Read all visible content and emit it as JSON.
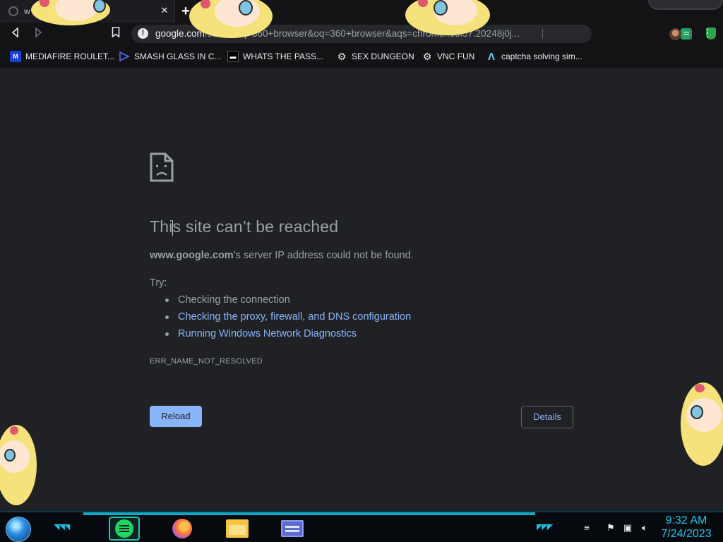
{
  "tab": {
    "title": "w",
    "close_label": "✕",
    "new_tab_label": "+"
  },
  "toolbar": {
    "url_host": "google.com",
    "url_rest": "/search?q=360+browser&oq=360+browser&aqs=chrome..69i57.20248j0j...",
    "menu_label": "⋮"
  },
  "bookmarks": [
    {
      "label": "MEDIAFIRE ROULET...",
      "icon": "mediafire-icon"
    },
    {
      "label": "SMASH GLASS IN C...",
      "icon": "smash-glass-icon"
    },
    {
      "label": "WHATS THE PASS...",
      "icon": "dark-tile-icon"
    },
    {
      "label": "SEX DUNGEON",
      "icon": "gear-icon"
    },
    {
      "label": "VNC FUN",
      "icon": "gear-icon"
    },
    {
      "label": "captcha solving sim...",
      "icon": "lambda-icon"
    }
  ],
  "error": {
    "title": "This site can’t be reached",
    "host": "www.google.com",
    "desc_suffix": "’s server IP address could not be found.",
    "try_label": "Try:",
    "suggestions": [
      "Checking the connection",
      "Checking the proxy, firewall, and DNS configuration",
      "Running Windows Network Diagnostics"
    ],
    "code": "ERR_NAME_NOT_RESOLVED",
    "reload_label": "Reload",
    "details_label": "Details"
  },
  "taskbar": {
    "time": "9:32 AM",
    "date": "7/24/2023",
    "apps": [
      "spotify-icon",
      "firefox-icon",
      "file-explorer-icon",
      "window-app-icon"
    ]
  },
  "colors": {
    "accent_link": "#8ab4f8",
    "page_bg": "#202124",
    "text_muted": "#9aa0a6",
    "clock": "#1ec6e8"
  }
}
